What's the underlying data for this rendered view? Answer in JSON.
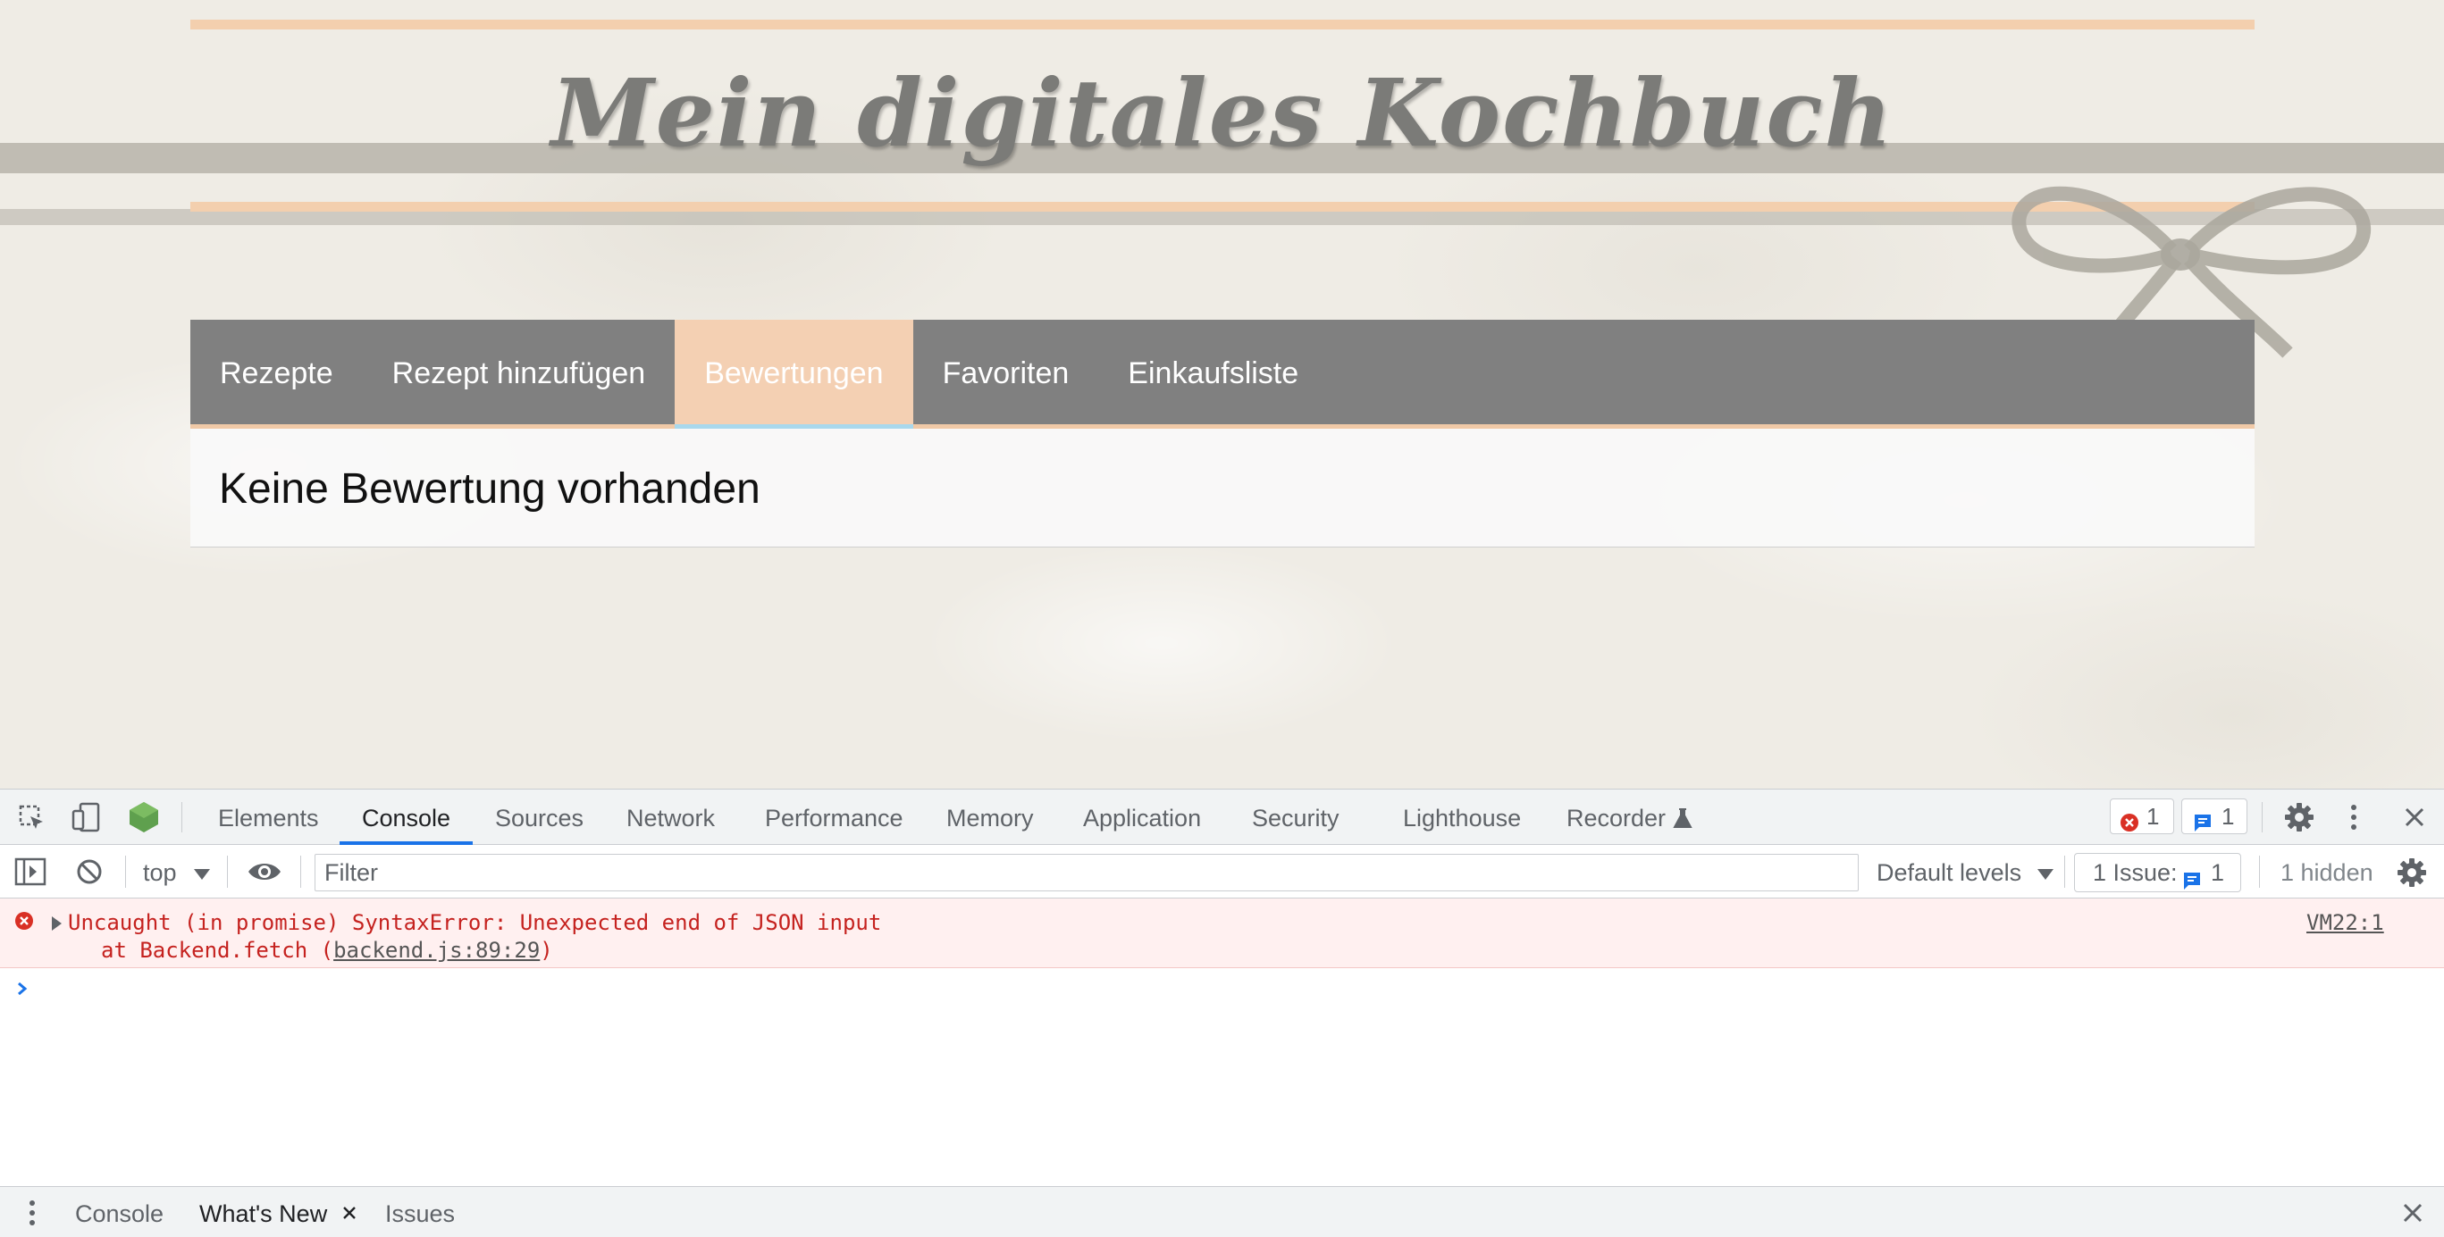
{
  "page": {
    "site_title": "Mein digitales Kochbuch",
    "nav": {
      "items": [
        {
          "label": "Rezepte",
          "active": false
        },
        {
          "label": "Rezept hinzufügen",
          "active": false
        },
        {
          "label": "Bewertungen",
          "active": true
        },
        {
          "label": "Favoriten",
          "active": false
        },
        {
          "label": "Einkaufsliste",
          "active": false
        }
      ]
    },
    "content_message": "Keine Bewertung vorhanden"
  },
  "devtools": {
    "tabs": [
      {
        "label": "Elements",
        "active": false
      },
      {
        "label": "Console",
        "active": true
      },
      {
        "label": "Sources",
        "active": false
      },
      {
        "label": "Network",
        "active": false
      },
      {
        "label": "Performance",
        "active": false
      },
      {
        "label": "Memory",
        "active": false
      },
      {
        "label": "Application",
        "active": false
      },
      {
        "label": "Security",
        "active": false
      },
      {
        "label": "Lighthouse",
        "active": false
      },
      {
        "label": "Recorder",
        "active": false
      }
    ],
    "error_count": "1",
    "message_count": "1",
    "console_bar": {
      "context": "top",
      "filter_placeholder": "Filter",
      "levels": "Default levels",
      "issues_label": "1 Issue:",
      "issues_count": "1",
      "hidden": "1 hidden"
    },
    "error": {
      "message": "Uncaught (in promise) SyntaxError: Unexpected end of JSON input",
      "stack_prefix": "at Backend.fetch (",
      "stack_link": "backend.js:89:29",
      "stack_suffix": ")",
      "source": "VM22:1"
    },
    "drawer": {
      "tabs": [
        {
          "label": "Console",
          "active": false
        },
        {
          "label": "What's New",
          "active": true
        },
        {
          "label": "Issues",
          "active": false
        }
      ]
    },
    "colors": {
      "accent_blue": "#1a73e8",
      "error_red": "#d93025",
      "nav_active": "#f4d0b3"
    }
  }
}
